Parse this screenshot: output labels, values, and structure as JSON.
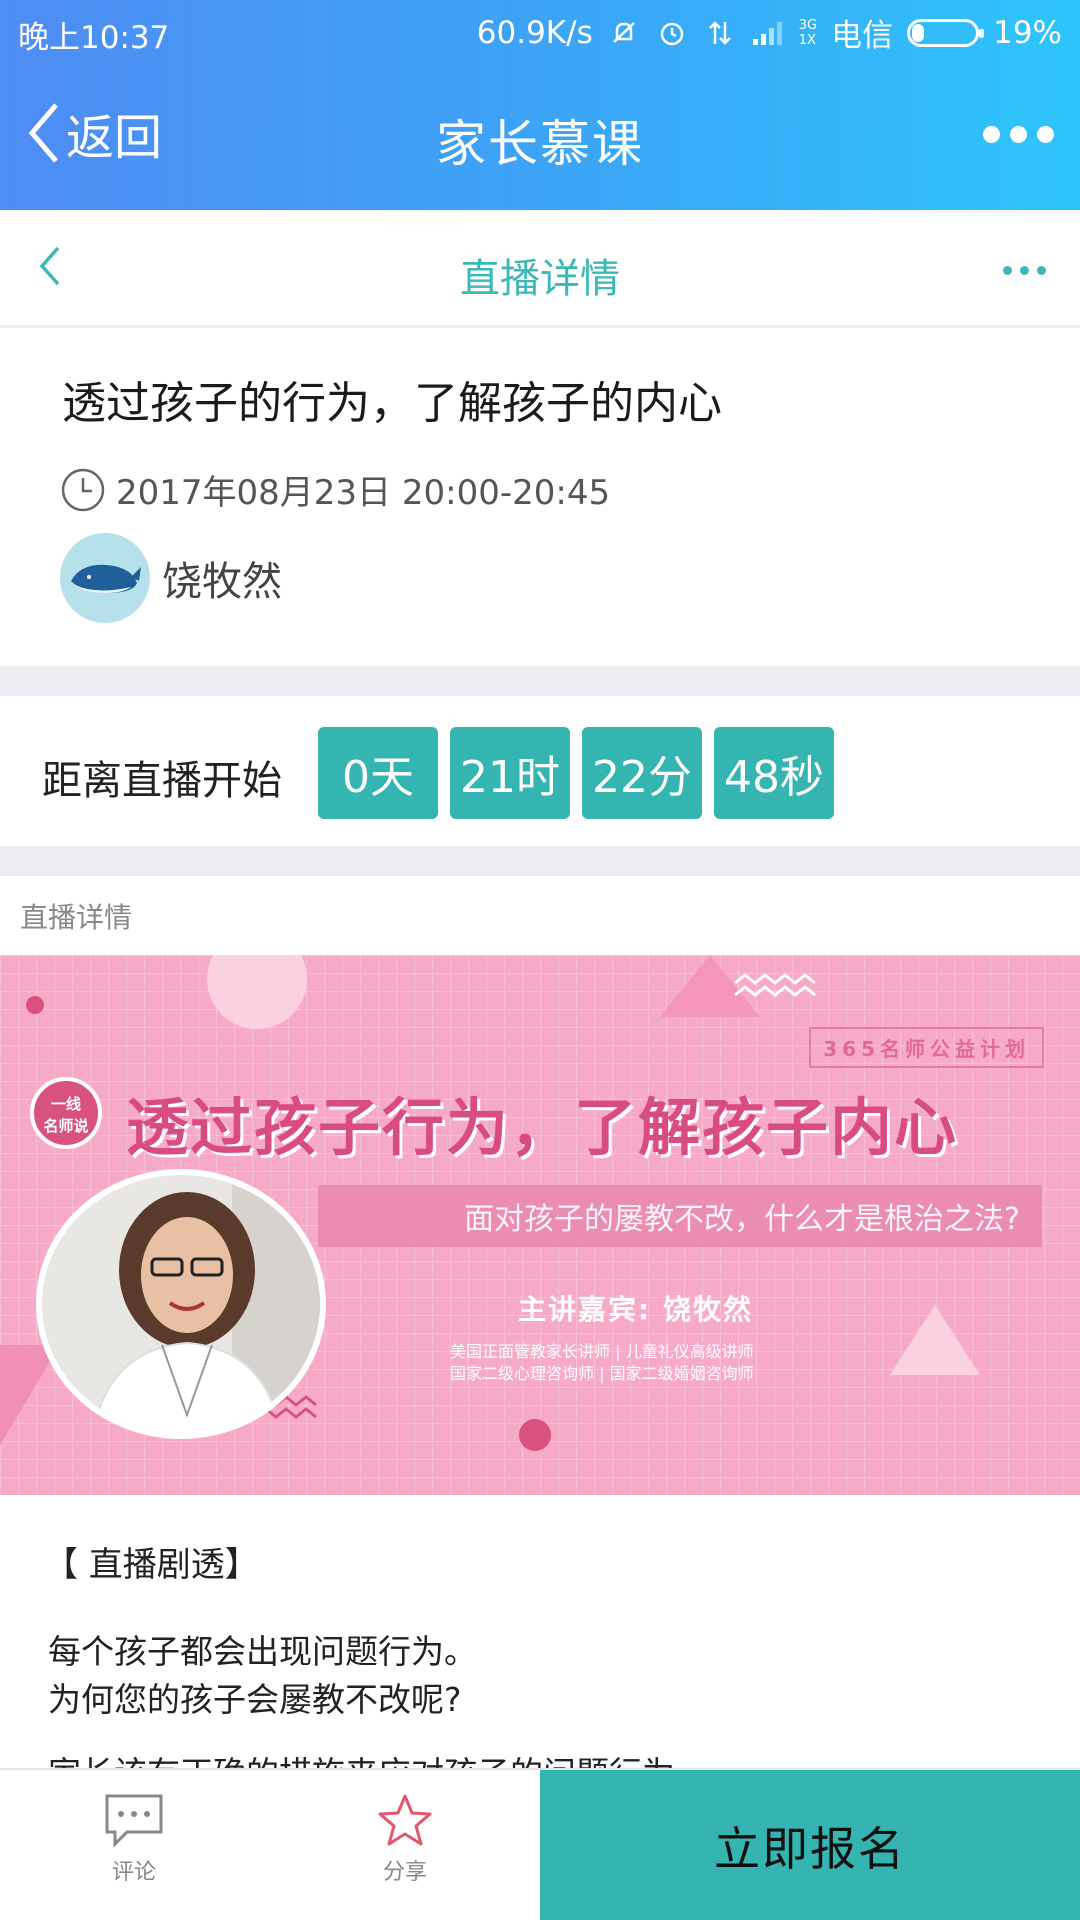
{
  "status_bar": {
    "time": "晚上10:37",
    "speed": "60.9K/s",
    "net_top": "3G",
    "net_bottom": "1X",
    "carrier": "电信",
    "battery": "19%",
    "battery_level": 0.19
  },
  "app_bar": {
    "back_label": "返回",
    "title": "家长慕课"
  },
  "sub_nav": {
    "title": "直播详情"
  },
  "course": {
    "title": "透过孩子的行为，了解孩子的内心",
    "datetime": "2017年08月23日 20:00-20:45",
    "teacher": "饶牧然"
  },
  "countdown": {
    "label": "距离直播开始",
    "days": "0天",
    "hours": "21时",
    "minutes": "22分",
    "seconds": "48秒"
  },
  "detail_section_label": "直播详情",
  "banner": {
    "plan": "365名师公益计划",
    "badge_line1": "一线",
    "badge_line2": "名师说",
    "headline": "透过孩子行为，了解孩子内心",
    "subtitle": "面对孩子的屡教不改，什么才是根治之法?",
    "guest": "主讲嘉宾:  饶牧然",
    "creds_line1": "美国正面管教家长讲师 | 儿童礼仪高级讲师",
    "creds_line2": "国家二级心理咨询师 | 国家二级婚姻咨询师"
  },
  "content": {
    "heading": "【 直播剧透】",
    "line1": "每个孩子都会出现问题行为。",
    "line2": "为何您的孩子会屡教不改呢?",
    "line3": "家长该有正确的措施来应对孩子的问题行为"
  },
  "bottom_bar": {
    "comment_label": "评论",
    "share_label": "分享",
    "signup_label": "立即报名"
  },
  "colors": {
    "header_gradient_start": "#4f8cf4",
    "header_gradient_end": "#2ec4fb",
    "accent_teal": "#35b5b2",
    "banner_pink": "#f7aac8"
  }
}
